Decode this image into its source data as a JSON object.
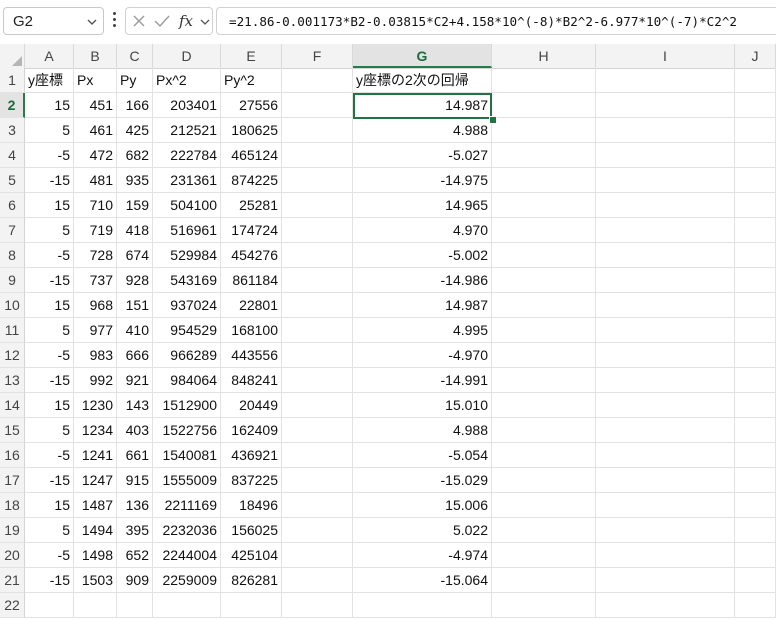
{
  "name_box": {
    "value": "G2"
  },
  "formula_bar": {
    "formula": "=21.86-0.001173*B2-0.03815*C2+4.158*10^(-8)*B2^2-6.977*10^(-7)*C2^2"
  },
  "colors": {
    "grid": "#e2e2e2",
    "selection": "#217346",
    "header_bg": "#f3f3f3"
  },
  "columns": [
    "A",
    "B",
    "C",
    "D",
    "E",
    "F",
    "G",
    "H",
    "I",
    "J"
  ],
  "active_cell": {
    "column": "G",
    "row": 2
  },
  "header_row": [
    "y座標",
    "Px",
    "Py",
    "Px^2",
    "Py^2",
    "",
    "y座標の2次の回帰"
  ],
  "rows": [
    [
      "15",
      "451",
      "166",
      "203401",
      "27556",
      "",
      "14.987"
    ],
    [
      "5",
      "461",
      "425",
      "212521",
      "180625",
      "",
      "4.988"
    ],
    [
      "-5",
      "472",
      "682",
      "222784",
      "465124",
      "",
      "-5.027"
    ],
    [
      "-15",
      "481",
      "935",
      "231361",
      "874225",
      "",
      "-14.975"
    ],
    [
      "15",
      "710",
      "159",
      "504100",
      "25281",
      "",
      "14.965"
    ],
    [
      "5",
      "719",
      "418",
      "516961",
      "174724",
      "",
      "4.970"
    ],
    [
      "-5",
      "728",
      "674",
      "529984",
      "454276",
      "",
      "-5.002"
    ],
    [
      "-15",
      "737",
      "928",
      "543169",
      "861184",
      "",
      "-14.986"
    ],
    [
      "15",
      "968",
      "151",
      "937024",
      "22801",
      "",
      "14.987"
    ],
    [
      "5",
      "977",
      "410",
      "954529",
      "168100",
      "",
      "4.995"
    ],
    [
      "-5",
      "983",
      "666",
      "966289",
      "443556",
      "",
      "-4.970"
    ],
    [
      "-15",
      "992",
      "921",
      "984064",
      "848241",
      "",
      "-14.991"
    ],
    [
      "15",
      "1230",
      "143",
      "1512900",
      "20449",
      "",
      "15.010"
    ],
    [
      "5",
      "1234",
      "403",
      "1522756",
      "162409",
      "",
      "4.988"
    ],
    [
      "-5",
      "1241",
      "661",
      "1540081",
      "436921",
      "",
      "-5.054"
    ],
    [
      "-15",
      "1247",
      "915",
      "1555009",
      "837225",
      "",
      "-15.029"
    ],
    [
      "15",
      "1487",
      "136",
      "2211169",
      "18496",
      "",
      "15.006"
    ],
    [
      "5",
      "1494",
      "395",
      "2232036",
      "156025",
      "",
      "5.022"
    ],
    [
      "-5",
      "1498",
      "652",
      "2244004",
      "425104",
      "",
      "-4.974"
    ],
    [
      "-15",
      "1503",
      "909",
      "2259009",
      "826281",
      "",
      "-15.064"
    ]
  ],
  "row_numbers": [
    "1",
    "2",
    "3",
    "4",
    "5",
    "6",
    "7",
    "8",
    "9",
    "10",
    "11",
    "12",
    "13",
    "14",
    "15",
    "16",
    "17",
    "18",
    "19",
    "20",
    "21",
    "22"
  ]
}
